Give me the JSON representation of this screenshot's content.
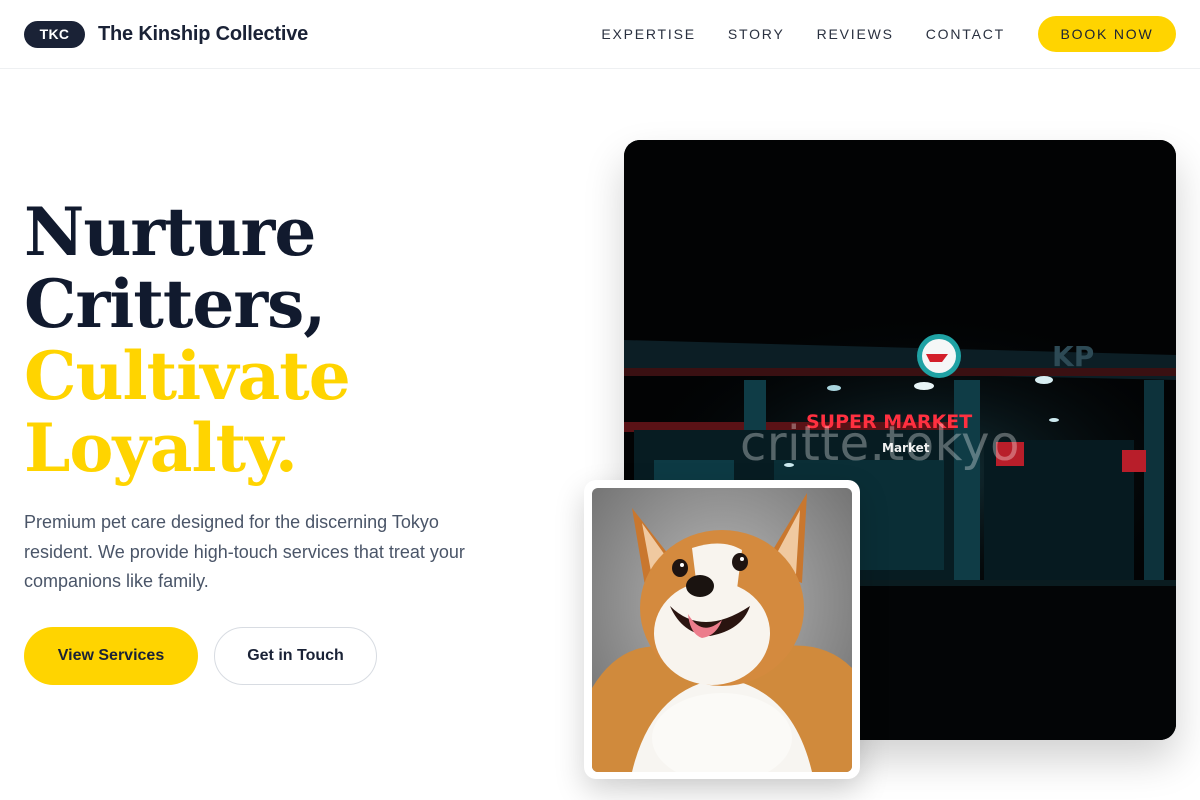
{
  "header": {
    "logo_badge": "TKC",
    "brand_name": "The Kinship Collective",
    "nav": [
      "EXPERTISE",
      "STORY",
      "REVIEWS",
      "CONTACT"
    ],
    "cta": "BOOK NOW"
  },
  "hero": {
    "headline": {
      "line1": "Nurture",
      "line2": "Critters,",
      "line3": "Cultivate",
      "line4": "Loyalty."
    },
    "description": "Premium pet care designed for the discerning Tokyo resident. We provide high-touch services that treat your companions like family.",
    "primary_button": "View Services",
    "secondary_button": "Get in Touch"
  },
  "images": {
    "store": {
      "watermark": "critte.tokyo",
      "sign_text": "SUPER MARKET",
      "sign_subtext": "Market",
      "corner_text": "KP"
    },
    "dog": {
      "alt": "corgi"
    }
  },
  "colors": {
    "accent": "#ffd400",
    "dark": "#111a2e",
    "text_muted": "#4a5568"
  }
}
